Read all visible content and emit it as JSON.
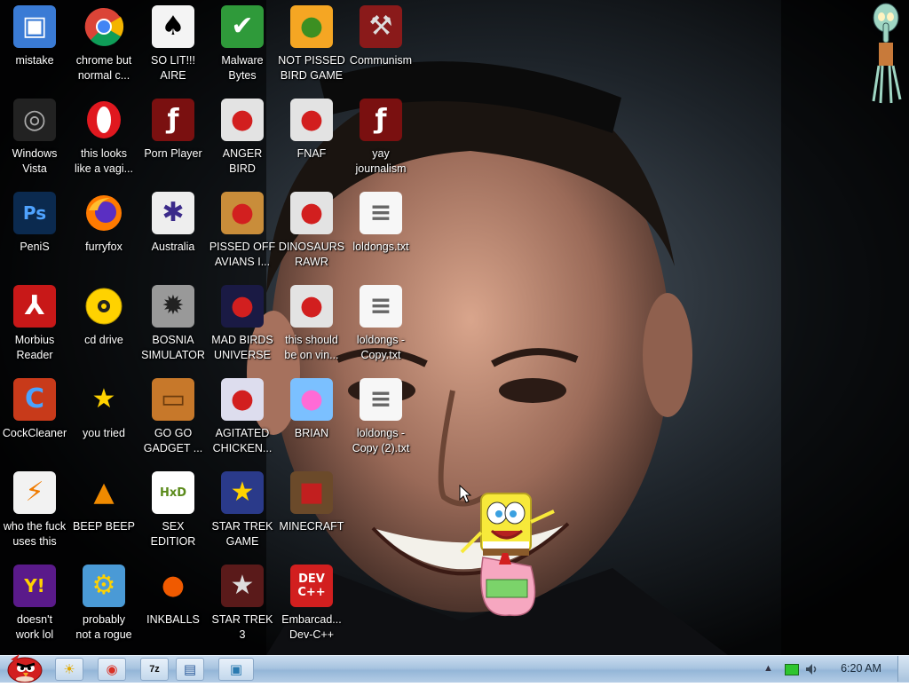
{
  "desktop": {
    "icons": [
      {
        "name": "icon-mistake",
        "label": "mistake",
        "icon": "computer-icon",
        "col": 0,
        "row": 0,
        "bg": "#3a7bd5",
        "fg": "#fff",
        "glyph": "▣"
      },
      {
        "name": "icon-chrome-but-normal",
        "label": "chrome but\nnormal c...",
        "icon": "chrome-icon",
        "col": 1,
        "row": 0,
        "bg": "chrome",
        "fg": "#fff",
        "glyph": ""
      },
      {
        "name": "icon-so-lit-aire",
        "label": "SO LIT!!!\nAIRE",
        "icon": "playing-card-icon",
        "col": 2,
        "row": 0,
        "bg": "#f4f4f4",
        "fg": "#000",
        "glyph": "♠"
      },
      {
        "name": "icon-malware-bytes",
        "label": "Malware\nBytes",
        "icon": "shield-icon",
        "col": 3,
        "row": 0,
        "bg": "#2f9a3a",
        "fg": "#fff",
        "glyph": "✔"
      },
      {
        "name": "icon-not-pissed-bird-game",
        "label": "NOT PISSED\nBIRD GAME",
        "icon": "green-pig-icon",
        "col": 4,
        "row": 0,
        "bg": "#f5a623",
        "fg": "#3c8f22",
        "glyph": "●"
      },
      {
        "name": "icon-communism",
        "label": "Communism",
        "icon": "red-emblem-icon",
        "col": 5,
        "row": 0,
        "bg": "#8a1a1a",
        "fg": "#ddd",
        "glyph": "⚒"
      },
      {
        "name": "icon-windows-vista",
        "label": "Windows\nVista",
        "icon": "trash-bin-icon",
        "col": 0,
        "row": 1,
        "bg": "#222",
        "fg": "#aaa",
        "glyph": "◎"
      },
      {
        "name": "icon-this-looks-like",
        "label": "this looks\nlike a vagi...",
        "icon": "opera-icon",
        "col": 1,
        "row": 1,
        "bg": "opera",
        "fg": "#fff",
        "glyph": ""
      },
      {
        "name": "icon-porn-player",
        "label": "Porn Player",
        "icon": "flash-icon",
        "col": 2,
        "row": 1,
        "bg": "#7a1010",
        "fg": "#fff",
        "glyph": "ƒ"
      },
      {
        "name": "icon-anger-bird",
        "label": "ANGER\nBIRD",
        "icon": "angry-bird-icon",
        "col": 3,
        "row": 1,
        "bg": "#e3e3e3",
        "fg": "#d21f1f",
        "glyph": "●"
      },
      {
        "name": "icon-fnaf",
        "label": "FNAF",
        "icon": "angry-bird-icon",
        "col": 4,
        "row": 1,
        "bg": "#e3e3e3",
        "fg": "#d21f1f",
        "glyph": "●"
      },
      {
        "name": "icon-yay-journalism",
        "label": "yay\njournalism",
        "icon": "flash-icon",
        "col": 5,
        "row": 1,
        "bg": "#7a1010",
        "fg": "#fff",
        "glyph": "ƒ"
      },
      {
        "name": "icon-penis",
        "label": "PeniS",
        "icon": "photoshop-icon",
        "col": 0,
        "row": 2,
        "bg": "#0b2a4f",
        "fg": "#4fa3ff",
        "glyph": "Ps"
      },
      {
        "name": "icon-furryfox",
        "label": "furryfox",
        "icon": "firefox-icon",
        "col": 1,
        "row": 2,
        "bg": "firefox",
        "fg": "#fff",
        "glyph": ""
      },
      {
        "name": "icon-australia",
        "label": "Australia",
        "icon": "spider-solitaire-icon",
        "col": 2,
        "row": 2,
        "bg": "#eee",
        "fg": "#3b2a8a",
        "glyph": "✱"
      },
      {
        "name": "icon-pissed-off-avians",
        "label": "PISSED OFF\nAVIANS I...",
        "icon": "angry-bird-seasons-icon",
        "col": 3,
        "row": 2,
        "bg": "#c98d3a",
        "fg": "#d21f1f",
        "glyph": "●"
      },
      {
        "name": "icon-dinosaurs-rawr",
        "label": "DINOSAURS\nRAWR",
        "icon": "angry-bird-icon",
        "col": 4,
        "row": 2,
        "bg": "#e3e3e3",
        "fg": "#d21f1f",
        "glyph": "●"
      },
      {
        "name": "icon-loldongs-txt",
        "label": "loldongs.txt",
        "icon": "text-file-icon",
        "col": 5,
        "row": 2,
        "bg": "#f7f7f7",
        "fg": "#666",
        "glyph": "≡"
      },
      {
        "name": "icon-morbius-reader",
        "label": "Morbius\nReader",
        "icon": "adobe-reader-icon",
        "col": 0,
        "row": 3,
        "bg": "#c81818",
        "fg": "#fff",
        "glyph": "⅄"
      },
      {
        "name": "icon-cd-drive",
        "label": "cd drive",
        "icon": "cd-icon",
        "col": 1,
        "row": 3,
        "bg": "cd",
        "fg": "#000",
        "glyph": ""
      },
      {
        "name": "icon-bosnia-simulator",
        "label": "BOSNIA\nSIMULATOR",
        "icon": "mine-icon",
        "col": 2,
        "row": 3,
        "bg": "#999",
        "fg": "#222",
        "glyph": "✹"
      },
      {
        "name": "icon-mad-birds-universe",
        "label": "MAD BIRDS\nUNIVERSE",
        "icon": "angry-bird-space-icon",
        "col": 3,
        "row": 3,
        "bg": "#1a1a44",
        "fg": "#d21f1f",
        "glyph": "●"
      },
      {
        "name": "icon-this-should-be-on-vin",
        "label": "this should\nbe on vin...",
        "icon": "angry-bird-icon",
        "col": 4,
        "row": 3,
        "bg": "#e3e3e3",
        "fg": "#d21f1f",
        "glyph": "●"
      },
      {
        "name": "icon-loldongs-copy",
        "label": "loldongs -\nCopy.txt",
        "icon": "text-file-icon",
        "col": 5,
        "row": 3,
        "bg": "#f7f7f7",
        "fg": "#666",
        "glyph": "≡"
      },
      {
        "name": "icon-cockcleaner",
        "label": "CockCleaner",
        "icon": "ccleaner-icon",
        "col": 0,
        "row": 4,
        "bg": "#c83a1a",
        "fg": "#4aa3ff",
        "glyph": "C"
      },
      {
        "name": "icon-you-tried",
        "label": "you tried",
        "icon": "star-icon",
        "col": 1,
        "row": 4,
        "bg": "transparent",
        "fg": "#ffd200",
        "glyph": "★"
      },
      {
        "name": "icon-go-go-gadget",
        "label": "GO GO\nGADGET ...",
        "icon": "briefcase-icon",
        "col": 2,
        "row": 4,
        "bg": "#c7782a",
        "fg": "#6b3b0d",
        "glyph": "▭"
      },
      {
        "name": "icon-agitated-chicken",
        "label": "AGITATED\nCHICKEN...",
        "icon": "angry-bird-rio-icon",
        "col": 3,
        "row": 4,
        "bg": "#dde",
        "fg": "#d21f1f",
        "glyph": "●"
      },
      {
        "name": "icon-brian",
        "label": "BRIAN",
        "icon": "bird-with-hat-icon",
        "col": 4,
        "row": 4,
        "bg": "#7bc0ff",
        "fg": "#ff6bd6",
        "glyph": "●"
      },
      {
        "name": "icon-loldongs-copy-2",
        "label": "loldongs -\nCopy (2).txt",
        "icon": "text-file-icon",
        "col": 5,
        "row": 4,
        "bg": "#f7f7f7",
        "fg": "#666",
        "glyph": "≡"
      },
      {
        "name": "icon-who-uses-this",
        "label": "who the fuck\nuses this",
        "icon": "winamp-icon",
        "col": 0,
        "row": 5,
        "bg": "#f2f2f2",
        "fg": "#f07b00",
        "glyph": "⚡"
      },
      {
        "name": "icon-beep-beep",
        "label": "BEEP BEEP",
        "icon": "vlc-cone-icon",
        "col": 1,
        "row": 5,
        "bg": "transparent",
        "fg": "#f08a00",
        "glyph": "▲"
      },
      {
        "name": "icon-sex-editior",
        "label": "SEX\nEDITIOR",
        "icon": "hxd-icon",
        "col": 2,
        "row": 5,
        "bg": "#fff",
        "fg": "#5a8a1a",
        "glyph": "HxD"
      },
      {
        "name": "icon-star-trek-game",
        "label": "STAR TREK\nGAME",
        "icon": "angry-bird-star-wars-icon",
        "col": 3,
        "row": 5,
        "bg": "#2a3a8a",
        "fg": "#ffd200",
        "glyph": "★"
      },
      {
        "name": "icon-minecraft",
        "label": "MINECRAFT",
        "icon": "minecraft-icon",
        "col": 4,
        "row": 5,
        "bg": "#6b4a2a",
        "fg": "#c21f1f",
        "glyph": "■"
      },
      {
        "name": "icon-doesnt-work-lol",
        "label": "doesn't\nwork lol",
        "icon": "yahoo-messenger-icon",
        "col": 0,
        "row": 6,
        "bg": "#5a1a8a",
        "fg": "#ffd200",
        "glyph": "Y!"
      },
      {
        "name": "icon-probably-not-a-rogue",
        "label": "probably\nnot a rogue",
        "icon": "gears-icon",
        "col": 1,
        "row": 6,
        "bg": "#4a9ad6",
        "fg": "#ffd200",
        "glyph": "⚙"
      },
      {
        "name": "icon-inkballs",
        "label": "INKBALLS",
        "icon": "inkball-icon",
        "col": 2,
        "row": 6,
        "bg": "transparent",
        "fg": "#f05a00",
        "glyph": "●"
      },
      {
        "name": "icon-star-trek-3",
        "label": "STAR TREK\n3",
        "icon": "angry-bird-star-wars-2-icon",
        "col": 3,
        "row": 6,
        "bg": "#5a1a1a",
        "fg": "#ddd",
        "glyph": "★"
      },
      {
        "name": "icon-embarcadero-dev-cpp",
        "label": "Embarcad...\nDev-C++",
        "icon": "dev-cpp-icon",
        "col": 4,
        "row": 6,
        "bg": "#d21f1f",
        "fg": "#fff",
        "glyph": "DEV\nC++"
      }
    ]
  },
  "taskbar": {
    "start_icon": "angry-bird-start-icon",
    "pinned": [
      {
        "name": "taskbar-explorer-button",
        "icon": "sun-icon",
        "glyph": "☀",
        "color": "#e0a800"
      },
      {
        "name": "taskbar-chrome-button",
        "icon": "chrome-icon",
        "glyph": "◉",
        "color": "#d93025"
      },
      {
        "name": "taskbar-7zip-button",
        "icon": "7zip-icon",
        "glyph": "7z",
        "color": "#111"
      },
      {
        "name": "taskbar-file-manager-button",
        "icon": "window-icon",
        "glyph": "▤",
        "color": "#2a5a9a"
      },
      {
        "name": "taskbar-app-window-button",
        "icon": "app-window-icon",
        "glyph": "▣",
        "color": "#2a7ab0"
      }
    ],
    "tray_arrow": "▲",
    "clock": "6:20 AM"
  }
}
